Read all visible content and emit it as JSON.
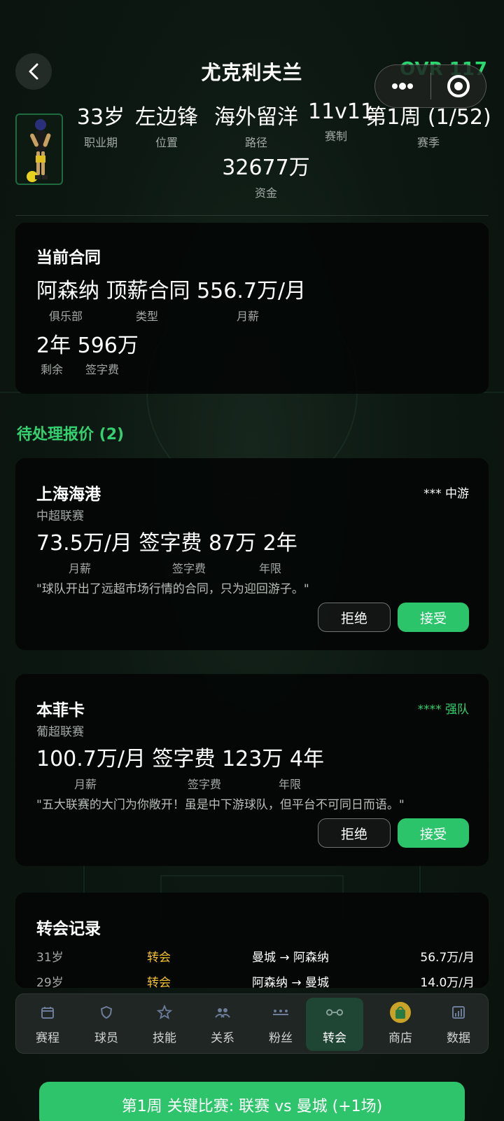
{
  "header": {
    "back_label": "<",
    "title": "尤克利夫兰",
    "ovr": "OVR 117"
  },
  "stats": [
    {
      "value": "33岁",
      "label": "职业期"
    },
    {
      "value": "左边锋",
      "label": "位置"
    },
    {
      "value": "海外留洋",
      "label": "路径"
    },
    {
      "value": "11v11",
      "label": "赛制"
    },
    {
      "value": "第1周 (1/52)",
      "label": "赛季"
    }
  ],
  "funds": {
    "value": "32677万",
    "label": "资金"
  },
  "contract": {
    "title": "当前合同",
    "line1": "阿森纳 顶薪合同 556.7万/月",
    "labels1": [
      "俱乐部",
      "类型",
      "月薪"
    ],
    "line2": "2年 596万",
    "labels2": [
      "剩余",
      "签字费"
    ]
  },
  "offers_heading": "待处理报价 (2)",
  "offers": [
    {
      "club": "上海海港",
      "league": "中超联赛",
      "tier": "*** 中游",
      "terms": "73.5万/月 签字费 87万 2年",
      "labels": [
        "月薪",
        "签字费",
        "年限"
      ],
      "quote": "\"球队开出了远超市场行情的合同，只为迎回游子。\"",
      "reject": "拒绝",
      "accept": "接受"
    },
    {
      "club": "本菲卡",
      "league": "葡超联赛",
      "tier": "**** 强队",
      "terms": "100.7万/月 签字费 123万 4年",
      "labels": [
        "月薪",
        "签字费",
        "年限"
      ],
      "quote": "\"五大联赛的大门为你敞开！虽是中下游球队，但平台不可同日而语。\"",
      "reject": "拒绝",
      "accept": "接受"
    }
  ],
  "history": {
    "title": "转会记录",
    "rows": [
      {
        "age": "31岁",
        "type": "转会",
        "route": "曼城 → 阿森纳",
        "salary": "56.7万/月"
      },
      {
        "age": "29岁",
        "type": "转会",
        "route": "阿森纳 → 曼城",
        "salary": "14.0万/月"
      }
    ]
  },
  "nav": [
    {
      "label": "赛程",
      "icon": "calendar-icon"
    },
    {
      "label": "球员",
      "icon": "shield-icon"
    },
    {
      "label": "技能",
      "icon": "star-icon"
    },
    {
      "label": "关系",
      "icon": "people-icon"
    },
    {
      "label": "粉丝",
      "icon": "fans-icon"
    },
    {
      "label": "转会",
      "icon": "transfer-icon",
      "active": true
    },
    {
      "label": "商店",
      "icon": "shop-bag-icon"
    },
    {
      "label": "数据",
      "icon": "chart-icon"
    }
  ],
  "cta": "第1周 关键比赛: 联赛 vs 曼城 (+1场)",
  "colors": {
    "accent": "#2bc46a",
    "ovr": "#27d96e",
    "tier_strong": "#33d16f",
    "transfer": "#f2c230"
  }
}
